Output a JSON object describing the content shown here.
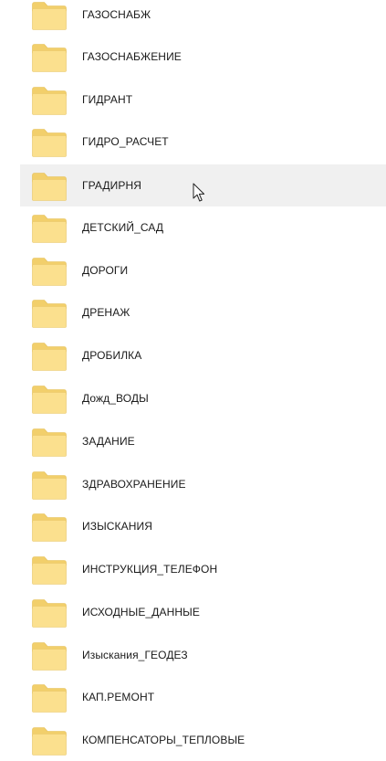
{
  "folders": [
    {
      "name": "ГАЗОСНАБЖ"
    },
    {
      "name": "ГАЗОСНАБЖЕНИЕ"
    },
    {
      "name": "ГИДРАНТ"
    },
    {
      "name": "ГИДРО_РАСЧЕТ"
    },
    {
      "name": "ГРАДИРНЯ",
      "hovered": true
    },
    {
      "name": "ДЕТСКИЙ_САД"
    },
    {
      "name": "ДОРОГИ"
    },
    {
      "name": "ДРЕНАЖ"
    },
    {
      "name": "ДРОБИЛКА"
    },
    {
      "name": "Дожд_ВОДЫ"
    },
    {
      "name": "ЗАДАНИЕ"
    },
    {
      "name": "ЗДРАВОХРАНЕНИЕ"
    },
    {
      "name": "ИЗЫСКАНИЯ"
    },
    {
      "name": "ИНСТРУКЦИЯ_ТЕЛЕФОН"
    },
    {
      "name": "ИСХОДНЫЕ_ДАННЫЕ"
    },
    {
      "name": "Изыскания_ГЕОДЕЗ"
    },
    {
      "name": "КАП.РЕМОНТ"
    },
    {
      "name": "КОМПЕНСАТОРЫ_ТЕПЛОВЫЕ"
    }
  ],
  "icons": {
    "folder": "folder-icon",
    "cursor": "mouse-pointer-icon"
  },
  "colors": {
    "folder_front": "#fbe08e",
    "folder_back": "#f2cf6b",
    "hover_background": "#f0f0f0",
    "text": "#1a1a1a"
  }
}
